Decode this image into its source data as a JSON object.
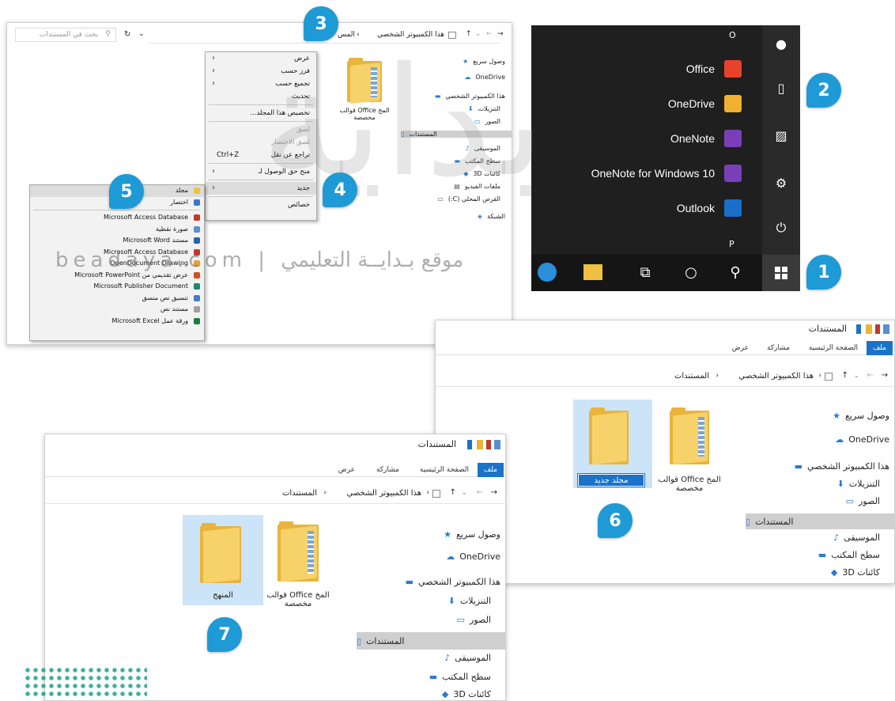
{
  "explorer1": {
    "path_root": "هذا الكمبيوتر الشخصي",
    "path_folder": "المس",
    "search_placeholder": "بحث في المستندات",
    "nav": [
      "وصول سريع",
      "OneDrive",
      "هذا الكمبيوتر الشخصي",
      "التنزيلات",
      "الصور",
      "المستندات",
      "الموسيقى",
      "سطح المكتب",
      "كائنات 3D",
      "ملفات الفيديو",
      "القرص المحلي (C:)",
      "الشبكة"
    ],
    "folder_label": "المخ Office قوالب مخصصة"
  },
  "context_menu": {
    "items": [
      {
        "label": "عرض",
        "arrow": true
      },
      {
        "label": "فرز حسب",
        "arrow": true
      },
      {
        "label": "تجميع حسب",
        "arrow": true
      },
      {
        "label": "تحديث"
      },
      {
        "label": "تخصيص هذا المجلد..."
      },
      {
        "label": "لصق",
        "disabled": true
      },
      {
        "label": "لصق الاختصار",
        "disabled": true
      },
      {
        "label": "تراجع عن نقل",
        "shortcut": "Ctrl+Z"
      },
      {
        "label": "منح حق الوصول لـ",
        "arrow": true
      },
      {
        "label": "جديد",
        "arrow": true
      },
      {
        "label": "خصائص"
      }
    ]
  },
  "new_submenu": {
    "items": [
      {
        "label": "مجلد",
        "color": "#f0c040"
      },
      {
        "label": "اختصار",
        "color": "#3a78c8"
      },
      {
        "label": "Microsoft Access Database",
        "color": "#c0392b"
      },
      {
        "label": "صورة نقطية",
        "color": "#5a8fd0"
      },
      {
        "label": "مستند Microsoft Word",
        "color": "#2b5fb4"
      },
      {
        "label": "Microsoft Access Database",
        "color": "#c0392b"
      },
      {
        "label": "OpenDocument Drawing",
        "color": "#e8a030"
      },
      {
        "label": "عرض تقديمي من Microsoft PowerPoint",
        "color": "#d05020"
      },
      {
        "label": "Microsoft Publisher Document",
        "color": "#1a8a6a"
      },
      {
        "label": "تنسيق نص منسق",
        "color": "#4a7ac8"
      },
      {
        "label": "مستند نص",
        "color": "#a0a0a0"
      },
      {
        "label": "ورقة عمل Microsoft Excel",
        "color": "#1e7a40"
      }
    ]
  },
  "start_menu": {
    "letter_o": "O",
    "letter_p": "P",
    "apps": [
      {
        "label": "Office",
        "color": "#e8432a"
      },
      {
        "label": "OneDrive",
        "color": "#f0b030"
      },
      {
        "label": "OneNote",
        "color": "#7a3fb8"
      },
      {
        "label": "OneNote for Windows 10",
        "color": "#7a3fb8"
      },
      {
        "label": "Outlook",
        "color": "#1a6fc8"
      }
    ]
  },
  "explorer2": {
    "title": "المستندات",
    "tabs": [
      "ملف",
      "الصفحة الرئيسية",
      "مشاركة",
      "عرض"
    ],
    "path_root": "هذا الكمبيوتر الشخصي",
    "path_folder": "المستندات",
    "nav": [
      "وصول سريع",
      "OneDrive",
      "هذا الكمبيوتر الشخصي",
      "التنزيلات",
      "الصور",
      "المستندات",
      "الموسيقى",
      "سطح المكتب",
      "كائنات 3D"
    ],
    "folder_label": "المخ Office قوالب مخصصة",
    "new_folder_name": "مجلد جديد"
  },
  "explorer3": {
    "title": "المستندات",
    "tabs": [
      "ملف",
      "الصفحة الرئيسية",
      "مشاركة",
      "عرض"
    ],
    "path_root": "هذا الكمبيوتر الشخصي",
    "path_folder": "المستندات",
    "nav": [
      "وصول سريع",
      "OneDrive",
      "هذا الكمبيوتر الشخصي",
      "التنزيلات",
      "الصور",
      "المستندات",
      "الموسيقى",
      "سطح المكتب",
      "كائنات 3D"
    ],
    "folder_label": "المخ Office قوالب مخصصة",
    "renamed_folder": "المنهج"
  },
  "steps": [
    "1",
    "2",
    "3",
    "4",
    "5",
    "6",
    "7"
  ],
  "watermark": {
    "logo_text": "بداية",
    "url_text": "beadaya.com | موقع بـدايــة التعليمي"
  },
  "colors": {
    "accent": "#1e9ad6",
    "ribbon_blue": "#1a73c9",
    "start_bg": "#1f1f1f",
    "selection": "#cce4f7"
  }
}
